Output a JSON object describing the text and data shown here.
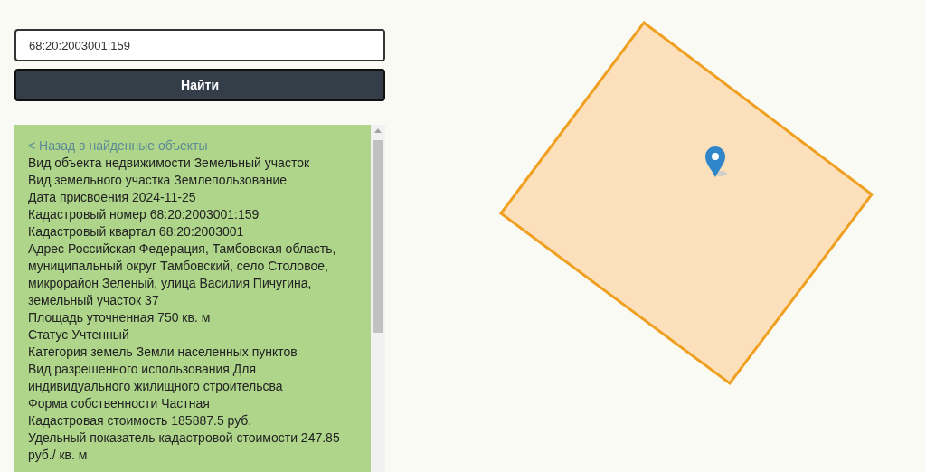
{
  "search": {
    "value": "68:20:2003001:159",
    "button": "Найти"
  },
  "details": {
    "back_link": "< Назад в найденные объекты",
    "lines": [
      "Вид объекта недвижимости Земельный участок",
      "Вид земельного участка Землепользование",
      "Дата присвоения 2024-11-25",
      "Кадастровый номер 68:20:2003001:159",
      "Кадастровый квартал 68:20:2003001",
      "Адрес Российская Федерация, Тамбовская область, муниципальный округ Тамбовский, село Столовое, микрорайон Зеленый, улица Василия Пичугина, земельный участок 37",
      "Площадь уточненная 750 кв. м",
      "Статус Учтенный",
      "Категория земель Земли населенных пунктов",
      "Вид разрешенного использования Для индивидуального жилищного строительсва",
      "Форма собственности Частная",
      "Кадастровая стоимость 185887.5 руб.",
      "Удельный показатель кадастровой стоимости 247.85 руб./ кв. м"
    ]
  }
}
